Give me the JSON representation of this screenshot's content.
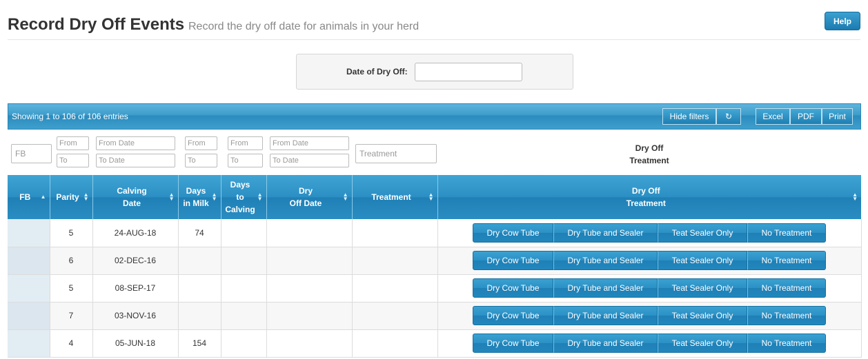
{
  "header": {
    "title": "Record Dry Off Events",
    "subtitle": "Record the dry off date for animals in your herd",
    "help_label": "Help"
  },
  "date_panel": {
    "label": "Date of Dry Off:",
    "value": ""
  },
  "toolbar": {
    "info": "Showing 1 to 106 of 106 entries",
    "hide_filters": "Hide filters",
    "refresh_icon": "refresh-icon",
    "excel": "Excel",
    "pdf": "PDF",
    "print": "Print"
  },
  "filters": {
    "fb_placeholder": "FB",
    "from": "From",
    "to": "To",
    "from_date": "From Date",
    "to_date": "To Date",
    "treatment_placeholder": "Treatment",
    "dry_off_treatment_line1": "Dry Off",
    "dry_off_treatment_line2": "Treatment"
  },
  "table": {
    "columns": [
      {
        "l1": "FB",
        "l2": ""
      },
      {
        "l1": "Parity",
        "l2": ""
      },
      {
        "l1": "Calving",
        "l2": "Date"
      },
      {
        "l1": "Days",
        "l2": "in Milk"
      },
      {
        "l1": "Days",
        "l2": "to",
        "l3": "Calving"
      },
      {
        "l1": "Dry",
        "l2": "Off Date"
      },
      {
        "l1": "Treatment",
        "l2": ""
      },
      {
        "l1": "Dry Off",
        "l2": "Treatment"
      }
    ],
    "actions": [
      "Dry Cow Tube",
      "Dry Tube and Sealer",
      "Teat Sealer Only",
      "No Treatment"
    ],
    "rows": [
      {
        "fb": "",
        "parity": "5",
        "calving_date": "24-AUG-18",
        "days_in_milk": "74",
        "days_to_calving": "",
        "dry_off_date": "",
        "treatment": ""
      },
      {
        "fb": "",
        "parity": "6",
        "calving_date": "02-DEC-16",
        "days_in_milk": "",
        "days_to_calving": "",
        "dry_off_date": "",
        "treatment": ""
      },
      {
        "fb": "",
        "parity": "5",
        "calving_date": "08-SEP-17",
        "days_in_milk": "",
        "days_to_calving": "",
        "dry_off_date": "",
        "treatment": ""
      },
      {
        "fb": "",
        "parity": "7",
        "calving_date": "03-NOV-16",
        "days_in_milk": "",
        "days_to_calving": "",
        "dry_off_date": "",
        "treatment": ""
      },
      {
        "fb": "",
        "parity": "4",
        "calving_date": "05-JUN-18",
        "days_in_milk": "154",
        "days_to_calving": "",
        "dry_off_date": "",
        "treatment": ""
      }
    ]
  },
  "colors": {
    "accent": "#2b8fc4",
    "header_text": "#ffffff"
  }
}
